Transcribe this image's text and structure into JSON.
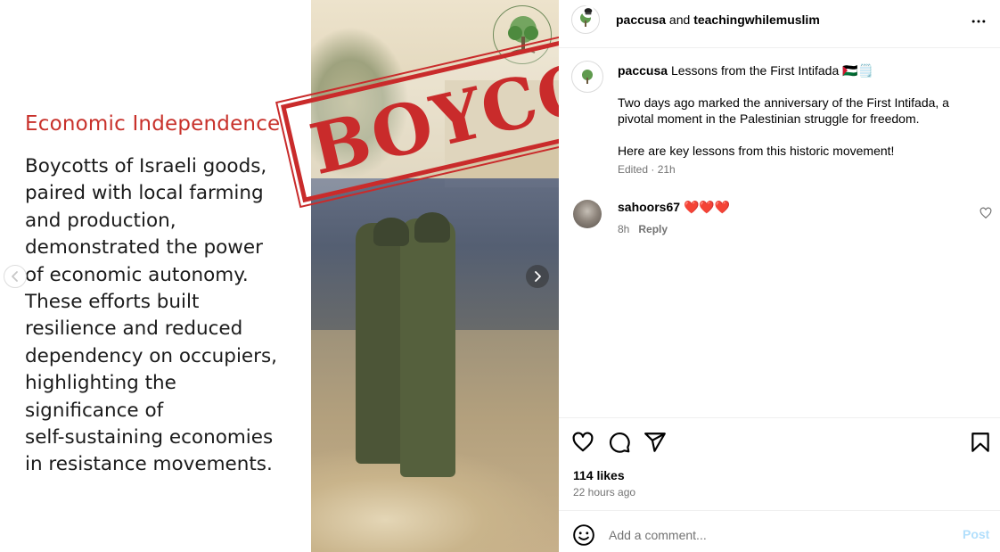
{
  "slide": {
    "heading": "Economic Independence",
    "body_lines": [
      "Boycotts of Israeli goods,",
      "paired with local farming",
      "and production,",
      "demonstrated the power",
      "of economic autonomy.",
      "These efforts built",
      "resilience and reduced",
      "dependency on occupiers,",
      "highlighting the",
      "significance of",
      "self-sustaining economies",
      "in resistance movements."
    ],
    "stamp_text": "BOYCO",
    "prev_icon": "chevron-left-icon",
    "next_icon": "chevron-right-icon"
  },
  "header": {
    "user1": "paccusa",
    "joiner": " and ",
    "user2": "teachingwhilemuslim",
    "more_icon": "more-horizontal-icon"
  },
  "caption": {
    "username": "paccusa",
    "title": "Lessons from the First Intifada 🇵🇸🗒️",
    "paragraph1": "Two days ago marked the anniversary of the First Intifada, a pivotal moment in the Palestinian struggle for freedom.",
    "paragraph2": "Here are key lessons from this historic movement!",
    "meta": "Edited · 21h"
  },
  "comment": {
    "username": "sahoors67",
    "text": "❤️❤️❤️",
    "time": "8h",
    "reply_label": "Reply"
  },
  "actions": {
    "likes": "114 likes",
    "time_ago": "22 hours ago"
  },
  "add_comment": {
    "placeholder": "Add a comment...",
    "post_label": "Post"
  },
  "colors": {
    "heading": "#c8312b",
    "stamp": "#c92b2b",
    "post_disabled": "#b2dffc",
    "muted": "#737373"
  }
}
